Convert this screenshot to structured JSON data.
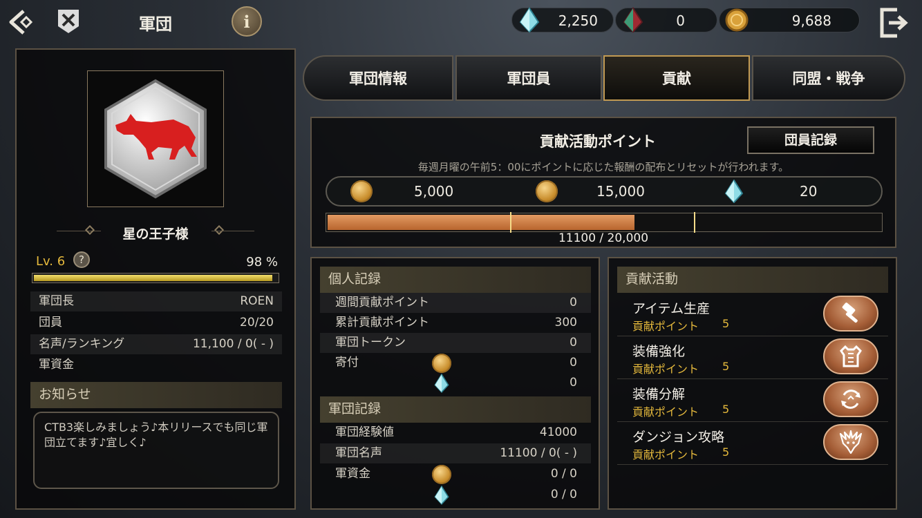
{
  "header": {
    "title": "軍団",
    "info_label": "i",
    "currencies": [
      {
        "icon": "blue-crystal-icon",
        "value": "2,250"
      },
      {
        "icon": "red-crystal-icon",
        "value": "0"
      },
      {
        "icon": "gold-coin-icon",
        "value": "9,688"
      }
    ]
  },
  "guild": {
    "name": "星の王子様",
    "level_label": "Lv. 6",
    "help_label": "?",
    "exp_percent": "98 %",
    "exp_fraction": 0.98,
    "stats": [
      {
        "label": "軍団長",
        "value": "ROEN"
      },
      {
        "label": "団員",
        "value": "20/20"
      },
      {
        "label": "名声/ランキング",
        "value": "11,100 / 0( - )"
      },
      {
        "label": "軍資金",
        "value": ""
      }
    ],
    "notice_header": "お知らせ",
    "notice_text": "CTB3楽しみましょう♪本リリースでも同じ軍団立てます♪宜しく♪"
  },
  "tabs": [
    "軍団情報",
    "軍団員",
    "貢献",
    "同盟・戦争"
  ],
  "active_tab": 2,
  "contribution": {
    "title": "貢献活動ポイント",
    "members_record_button": "団員記録",
    "note": "毎週月曜の午前5：00にポイントに応じた報酬の配布とリセットが行われます。",
    "rewards": [
      {
        "icon": "gold-medal-icon",
        "value": "5,000"
      },
      {
        "icon": "gold-medal-icon",
        "value": "15,000"
      },
      {
        "icon": "blue-crystal-icon",
        "value": "20"
      }
    ],
    "progress_text": "11100 / 20,000",
    "progress_fraction": 0.555
  },
  "personal": {
    "header": "個人記録",
    "rows": [
      {
        "label": "週間貢献ポイント",
        "value": "0"
      },
      {
        "label": "累計貢献ポイント",
        "value": "300"
      },
      {
        "label": "軍団トークン",
        "value": "0"
      },
      {
        "label": "寄付",
        "value": "0",
        "icon": "gold-medal-icon"
      },
      {
        "label": "",
        "value": "0",
        "icon": "blue-crystal-icon"
      }
    ]
  },
  "guild_record": {
    "header": "軍団記録",
    "rows": [
      {
        "label": "軍団経験値",
        "value": "41000"
      },
      {
        "label": "軍団名声",
        "value": "11100 / 0( - )"
      },
      {
        "label": "軍資金",
        "value": "0 / 0",
        "icon": "gold-medal-icon"
      },
      {
        "label": "",
        "value": "0 / 0",
        "icon": "blue-crystal-icon"
      }
    ]
  },
  "activities": {
    "header": "貢献活動",
    "items": [
      {
        "name": "アイテム生産",
        "points_label": "貢献ポイント",
        "points": "5",
        "icon": "hammer-icon"
      },
      {
        "name": "装備強化",
        "points_label": "貢献ポイント",
        "points": "5",
        "icon": "armor-icon"
      },
      {
        "name": "装備分解",
        "points_label": "貢献ポイント",
        "points": "5",
        "icon": "recycle-icon"
      },
      {
        "name": "ダンジョン攻略",
        "points_label": "貢献ポイント",
        "points": "5",
        "icon": "dragon-icon"
      }
    ]
  }
}
